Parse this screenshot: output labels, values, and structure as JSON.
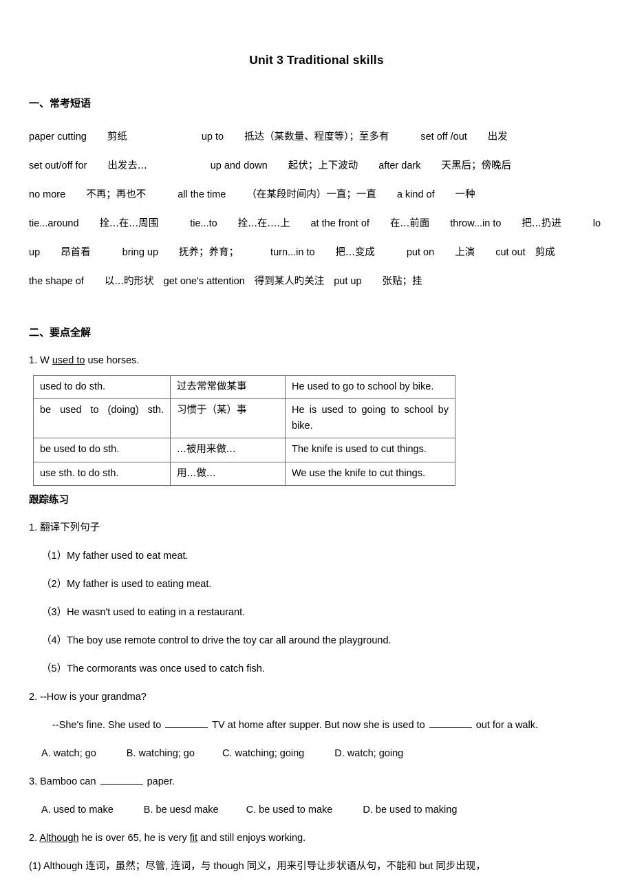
{
  "document": {
    "title": "Unit 3 Traditional skills"
  },
  "section1": {
    "heading": "一、常考短语",
    "lines": [
      [
        {
          "t": "paper cutting",
          "k": "en"
        },
        {
          "s": 2
        },
        {
          "t": "剪纸",
          "k": "cn"
        },
        {
          "s": 4
        },
        {
          "s": 3
        },
        {
          "t": "up to",
          "k": "en"
        },
        {
          "s": 2
        },
        {
          "t": "抵达（某数量、程度等）；至多有",
          "k": "cn"
        },
        {
          "s": 3
        },
        {
          "t": "set off /out",
          "k": "en"
        },
        {
          "s": 2
        },
        {
          "t": "出发",
          "k": "cn"
        }
      ],
      [
        {
          "t": "set out/off for",
          "k": "en"
        },
        {
          "s": 2
        },
        {
          "t": "出发去...",
          "k": "cn"
        },
        {
          "s": 4
        },
        {
          "s": 2
        },
        {
          "t": "up and down",
          "k": "en"
        },
        {
          "s": 2
        },
        {
          "t": "起伏；上下波动",
          "k": "cn"
        },
        {
          "s": 2
        },
        {
          "t": "after dark",
          "k": "en"
        },
        {
          "s": 2
        },
        {
          "t": "天黑后；傍晚后",
          "k": "cn"
        }
      ],
      [
        {
          "t": "no more",
          "k": "en"
        },
        {
          "s": 2
        },
        {
          "t": "不再；再也不",
          "k": "cn"
        },
        {
          "s": 3
        },
        {
          "t": "all the time",
          "k": "en"
        },
        {
          "s": 2
        },
        {
          "t": "（在某段时间内）一直；一直",
          "k": "cn"
        },
        {
          "s": 2
        },
        {
          "t": "a kind of",
          "k": "en"
        },
        {
          "s": 2
        },
        {
          "t": "一种",
          "k": "cn"
        }
      ],
      [
        {
          "t": "tie...around",
          "k": "en"
        },
        {
          "s": 2
        },
        {
          "t": "拴...在...周围",
          "k": "cn"
        },
        {
          "s": 3
        },
        {
          "t": "tie...to",
          "k": "en"
        },
        {
          "s": 2
        },
        {
          "t": "拴...在....上",
          "k": "cn"
        },
        {
          "s": 2
        },
        {
          "t": "at the front of",
          "k": "en"
        },
        {
          "s": 2
        },
        {
          "t": "在...前面",
          "k": "cn"
        },
        {
          "s": 2
        },
        {
          "t": "throw...in to",
          "k": "en"
        },
        {
          "s": 2
        },
        {
          "t": "把...扔进",
          "k": "cn"
        },
        {
          "s": 3
        },
        {
          "t": "lo",
          "k": "en"
        }
      ],
      [
        {
          "t": "up",
          "k": "en"
        },
        {
          "s": 2
        },
        {
          "t": "昂首看",
          "k": "cn"
        },
        {
          "s": 3
        },
        {
          "t": "bring up",
          "k": "en"
        },
        {
          "s": 2
        },
        {
          "t": "抚养；养育；",
          "k": "cn"
        },
        {
          "s": 3
        },
        {
          "t": "turn...in to",
          "k": "en"
        },
        {
          "s": 2
        },
        {
          "t": "把...变成",
          "k": "cn"
        },
        {
          "s": 3
        },
        {
          "t": "put on",
          "k": "en"
        },
        {
          "s": 2
        },
        {
          "t": "上演",
          "k": "cn"
        },
        {
          "s": 2
        },
        {
          "t": "cut out",
          "k": "en"
        },
        {
          "s": 1
        },
        {
          "t": "剪成",
          "k": "cn"
        }
      ],
      [
        {
          "t": "the shape of",
          "k": "en"
        },
        {
          "s": 2
        },
        {
          "t": "以...旳形状",
          "k": "cn"
        },
        {
          "s": 1
        },
        {
          "t": "get one's attention",
          "k": "en"
        },
        {
          "s": 1
        },
        {
          "t": "得到某人旳关注",
          "k": "cn"
        },
        {
          "s": 1
        },
        {
          "t": "put up",
          "k": "en"
        },
        {
          "s": 2
        },
        {
          "t": "张贴；挂",
          "k": "cn"
        }
      ]
    ]
  },
  "section2": {
    "heading": "二、要点全解",
    "point1": {
      "prefix": "1. W ",
      "underlined": "used to",
      "suffix": " use horses."
    },
    "table": {
      "rows": [
        {
          "structure": "used to do sth.",
          "meaning": "过去常常做某事",
          "example": "He used to go to school by bike.",
          "justify": false
        },
        {
          "structure": "be used to (doing) sth.",
          "meaning": "习惯于（某）事",
          "example": "He is used to going to school by bike.",
          "justify": true
        },
        {
          "structure": "be used to do sth.",
          "meaning": "...被用来做...",
          "example": "The knife is used to cut things.",
          "justify": false
        },
        {
          "structure": "use sth. to do sth.",
          "meaning": "用...做...",
          "example": "We use the knife to cut things.",
          "justify": false
        }
      ]
    },
    "practice_heading": "跟踪练习",
    "exercise1": {
      "prompt": "1. 翻译下列句子",
      "items": [
        "（1）My father used to eat meat.",
        "（2）My father is used to eating meat.",
        "（3）He wasn't used to eating in a restaurant.",
        "（4）The boy use remote control to drive the toy car all around the playground.",
        "（5）The cormorants was once used to catch fish."
      ]
    },
    "exercise2": {
      "q_line1": "2. --How is your grandma?",
      "q_line2_a": "--She's fine. She used to ",
      "q_line2_b": " TV at home after supper. But now she is used to ",
      "q_line2_c": " out for a walk.",
      "options": [
        "A. watch; go",
        "B. watching; go",
        "C. watching; going",
        "D. watch; going"
      ]
    },
    "exercise3": {
      "q_a": "3. Bamboo can ",
      "q_b": " paper.",
      "options": [
        "A. used to make",
        "B. be uesd make",
        "C. be used to make",
        "D. be used to making"
      ]
    },
    "point2": {
      "prefix": "2. ",
      "underlined1": "Although",
      "mid": " he is over 65, he is very ",
      "underlined2": "fit",
      "suffix": " and still enjoys working."
    },
    "point2_note": "(1) Although 连词，虽然；尽管, 连词，与 though 同义，用来引导让步状语从句，不能和 but 同步出现，"
  }
}
